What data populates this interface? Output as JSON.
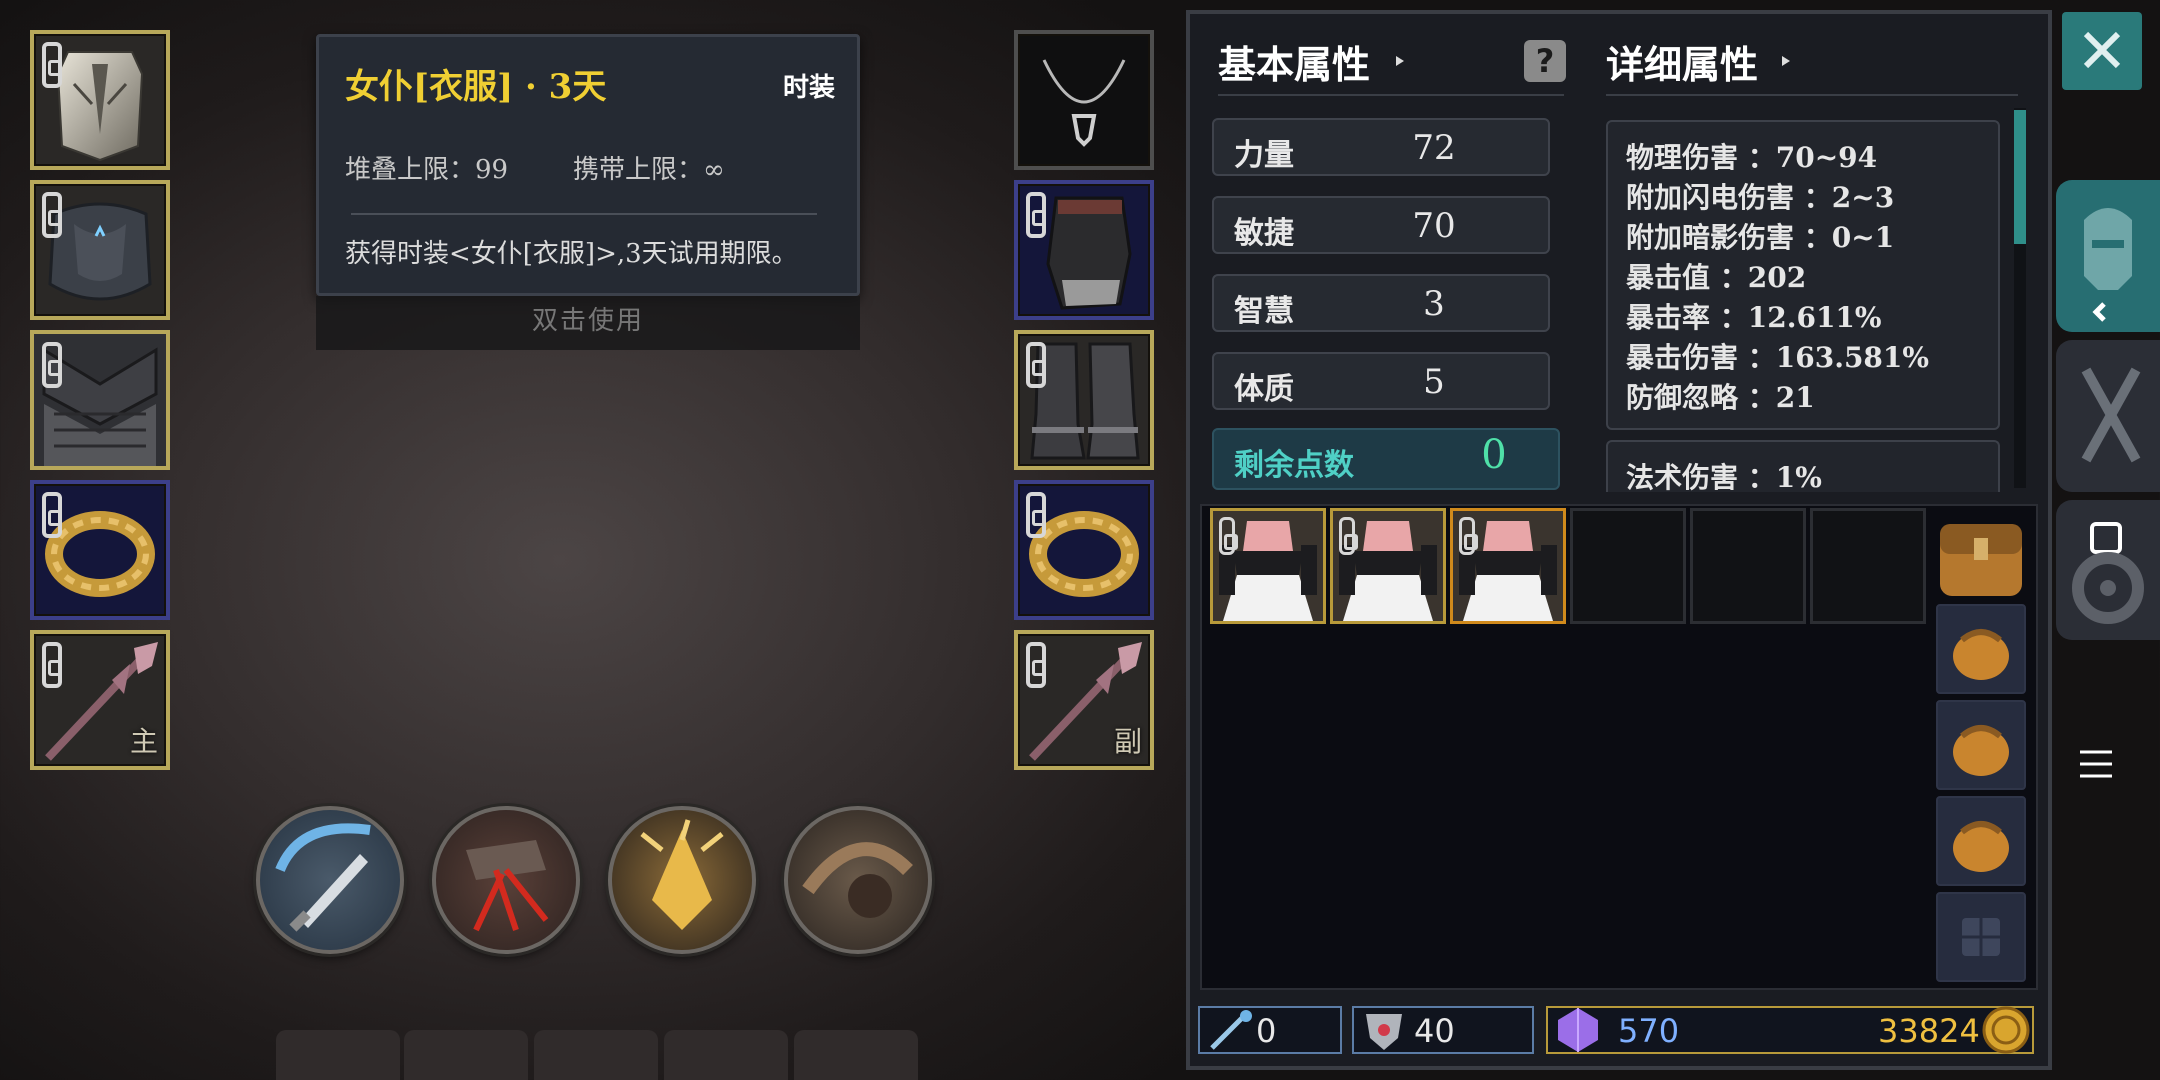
{
  "tooltip": {
    "title": "女仆[衣服] · 3天",
    "type": "时装",
    "stack_limit": "堆叠上限：99",
    "carry_limit": "携带上限：∞",
    "description": "获得时装<女仆[衣服]>,3天试用期限。",
    "use_hint": "双击使用"
  },
  "equipment": {
    "left": [
      {
        "icon": "helmet-icon",
        "locked": true,
        "border": "gold"
      },
      {
        "icon": "chest-armor-icon",
        "locked": true,
        "border": "gold"
      },
      {
        "icon": "chainmail-legs-icon",
        "locked": true,
        "border": "gold"
      },
      {
        "icon": "gold-ring-icon",
        "locked": true,
        "border": "blue"
      },
      {
        "icon": "spear-icon",
        "locked": true,
        "border": "gold",
        "tag": "主"
      }
    ],
    "right": [
      {
        "icon": "necklace-icon",
        "locked": false,
        "border": "dark"
      },
      {
        "icon": "gauntlet-icon",
        "locked": true,
        "border": "blue"
      },
      {
        "icon": "boots-icon",
        "locked": true,
        "border": "gold"
      },
      {
        "icon": "gold-ring-icon",
        "locked": true,
        "border": "blue"
      },
      {
        "icon": "spear-icon",
        "locked": true,
        "border": "gold",
        "tag": "副"
      }
    ]
  },
  "skills": [
    "sword-slash-icon",
    "blood-strike-icon",
    "golden-burst-icon",
    "charge-dash-icon"
  ],
  "basic": {
    "title": "基本属性",
    "stats": [
      {
        "name": "力量",
        "value": "72"
      },
      {
        "name": "敏捷",
        "value": "70"
      },
      {
        "name": "智慧",
        "value": "3"
      },
      {
        "name": "体质",
        "value": "5"
      }
    ],
    "remaining_label": "剩余点数",
    "remaining_value": "0"
  },
  "detail": {
    "title": "详细属性",
    "lines": [
      "物理伤害 ：70~94",
      "附加闪电伤害 ：2~3",
      "附加暗影伤害 ：0~1",
      "暴击值 ：202",
      "暴击率 ：12.611%",
      "暴击伤害 ：163.581%",
      "防御忽略 ：21"
    ],
    "second_box_line": "法术伤害 ：1%"
  },
  "inventory": {
    "items": [
      "maid-outfit-icon",
      "maid-outfit-icon",
      "maid-outfit-icon",
      "",
      "",
      ""
    ],
    "bags": [
      "backpack-icon",
      "pouch-icon",
      "pouch-icon",
      "pouch-icon",
      "empty-bag-icon"
    ]
  },
  "currency": {
    "skill_points": "0",
    "shield_tokens": "40",
    "crystals": "570",
    "gold": "33824"
  },
  "colors": {
    "gold_border": "#b8a85a",
    "blue_border": "#3c3f8a",
    "accent_teal": "#2a7a7a",
    "title_yellow": "#f0cf33"
  }
}
